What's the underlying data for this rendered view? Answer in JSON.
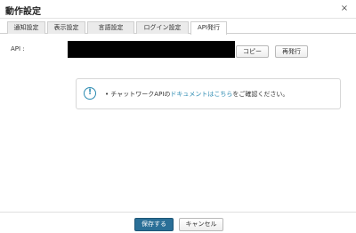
{
  "dialog": {
    "title": "動作設定",
    "close_glyph": "×"
  },
  "tabs": [
    {
      "label": "通知設定",
      "active": false
    },
    {
      "label": "表示設定",
      "active": false
    },
    {
      "label": "言語設定",
      "active": false
    },
    {
      "label": "ログイン設定",
      "active": false
    },
    {
      "label": "API発行",
      "active": true
    }
  ],
  "api": {
    "label": "API :",
    "copy_label": "コピー",
    "reissue_label": "再発行"
  },
  "notice": {
    "icon_glyph": "!",
    "bullet": "•",
    "text_before": "チャットワークAPIの",
    "link_text": "ドキュメントはこちら",
    "text_after": "をご確認ください。"
  },
  "footer": {
    "save_label": "保存する",
    "cancel_label": "キャンセル"
  },
  "colors": {
    "accent": "#2b8ab1",
    "primary_button": "#2a6f97",
    "token_mask": "#000000"
  }
}
